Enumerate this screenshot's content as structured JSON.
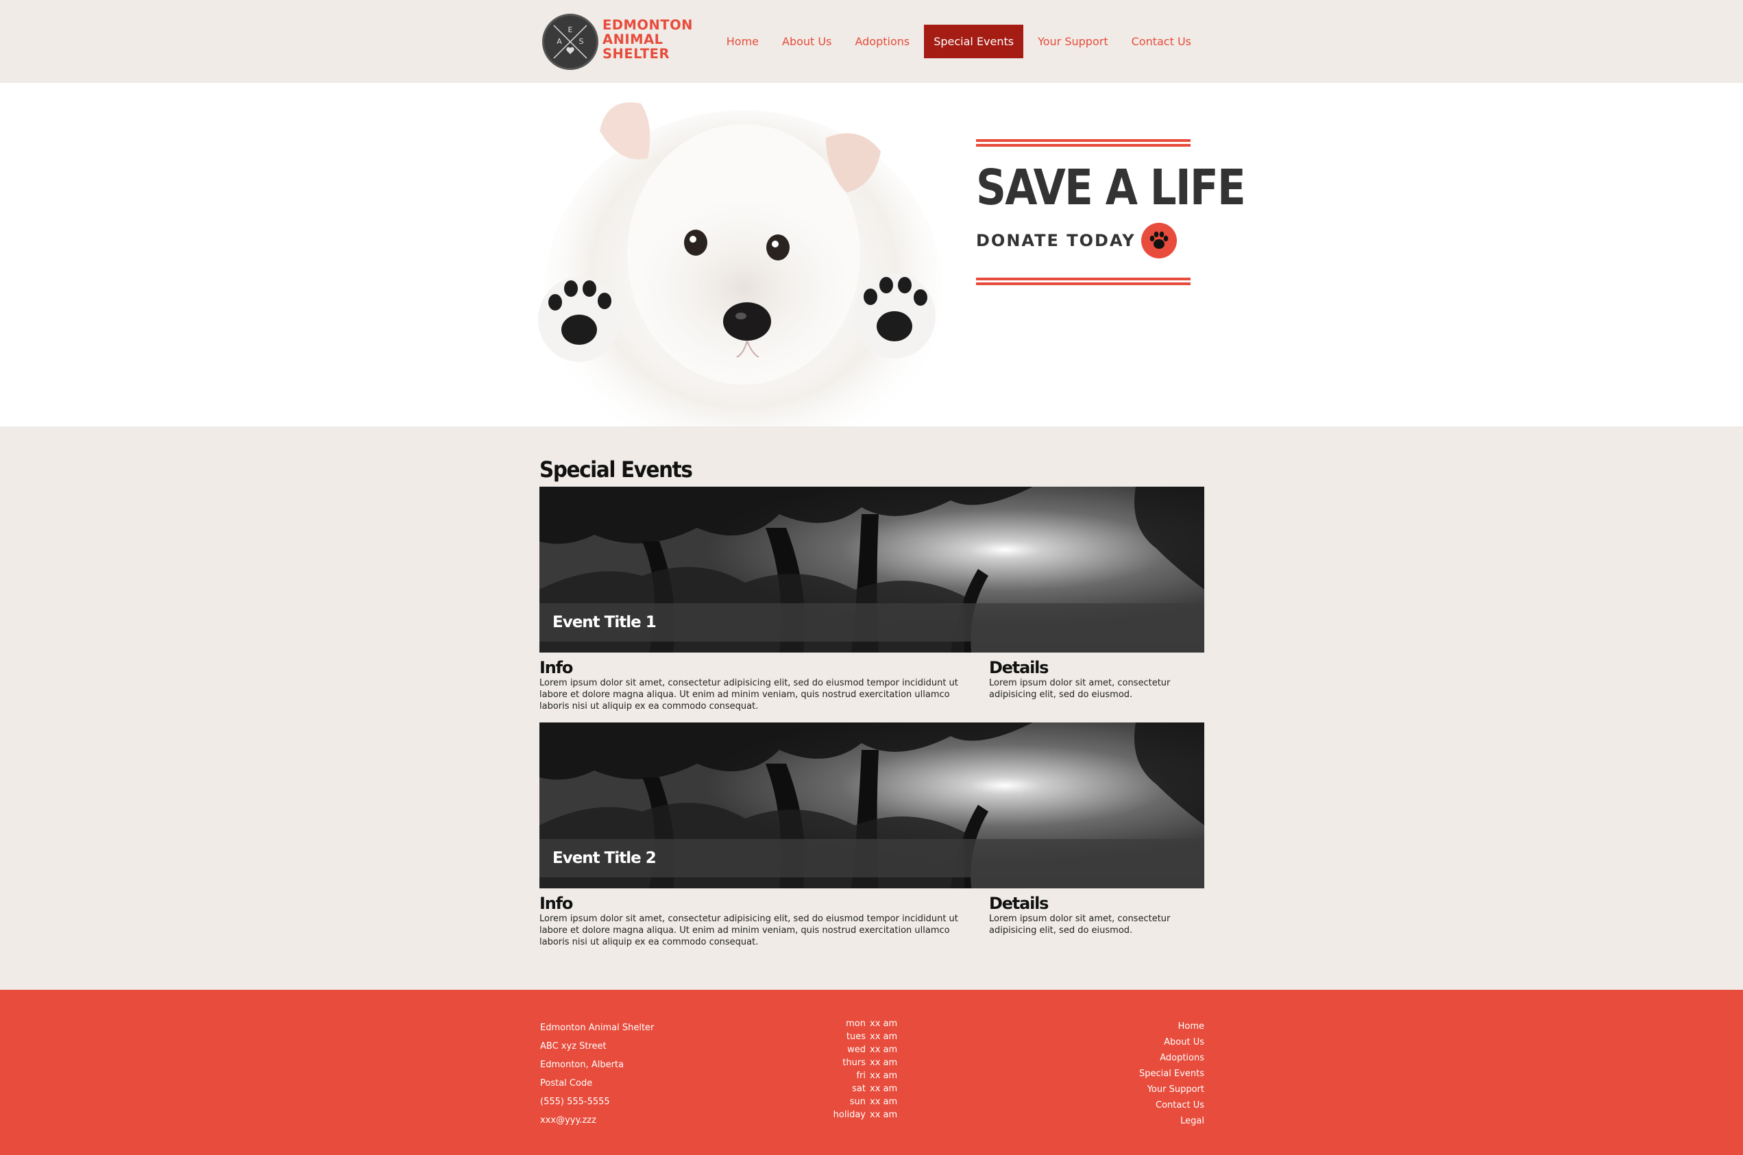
{
  "brand": {
    "logo_letters": [
      "E",
      "A",
      "S"
    ],
    "name_lines": [
      "EDMONTON",
      "ANIMAL",
      "SHELTER"
    ]
  },
  "nav": {
    "items": [
      {
        "label": "Home",
        "active": false
      },
      {
        "label": "About Us",
        "active": false
      },
      {
        "label": "Adoptions",
        "active": false
      },
      {
        "label": "Special Events",
        "active": true
      },
      {
        "label": "Your Support",
        "active": false
      },
      {
        "label": "Contact Us",
        "active": false
      }
    ]
  },
  "hero": {
    "headline": "SAVE A LIFE",
    "cta": "DONATE TODAY",
    "cta_icon": "paw-icon"
  },
  "events": {
    "section_title": "Special Events",
    "items": [
      {
        "title": "Event Title 1",
        "info_heading": "Info",
        "info_text": "Lorem ipsum dolor sit amet, consectetur adipisicing elit, sed do eiusmod tempor incididunt ut labore et dolore magna aliqua. Ut enim ad minim veniam, quis nostrud exercitation ullamco laboris nisi ut aliquip ex ea commodo consequat.",
        "details_heading": "Details",
        "details_text": "Lorem ipsum dolor sit amet, consectetur adipisicing elit, sed do eiusmod."
      },
      {
        "title": "Event Title 2",
        "info_heading": "Info",
        "info_text": "Lorem ipsum dolor sit amet, consectetur adipisicing elit, sed do eiusmod tempor incididunt ut labore et dolore magna aliqua. Ut enim ad minim veniam, quis nostrud exercitation ullamco laboris nisi ut aliquip ex ea commodo consequat.",
        "details_heading": "Details",
        "details_text": "Lorem ipsum dolor sit amet, consectetur adipisicing elit, sed do eiusmod."
      }
    ]
  },
  "footer": {
    "address": {
      "name": "Edmonton Animal Shelter",
      "street": "ABC xyz Street",
      "city": "Edmonton, Alberta",
      "postal": "Postal Code",
      "phone": "(555) 555-5555",
      "email": "xxx@yyy.zzz"
    },
    "hours": [
      {
        "day": "mon",
        "time": "xx am"
      },
      {
        "day": "tues",
        "time": "xx am"
      },
      {
        "day": "wed",
        "time": "xx am"
      },
      {
        "day": "thurs",
        "time": "xx am"
      },
      {
        "day": "fri",
        "time": "xx am"
      },
      {
        "day": "sat",
        "time": "xx am"
      },
      {
        "day": "sun",
        "time": "xx am"
      },
      {
        "day": "holiday",
        "time": "xx am"
      }
    ],
    "links": [
      "Home",
      "About Us",
      "Adoptions",
      "Special Events",
      "Your Support",
      "Contact Us",
      "Legal"
    ]
  },
  "colors": {
    "accent": "#e74c3c",
    "nav_active": "#a51c14",
    "background": "#f0ebe6",
    "dark_text": "#333333"
  }
}
